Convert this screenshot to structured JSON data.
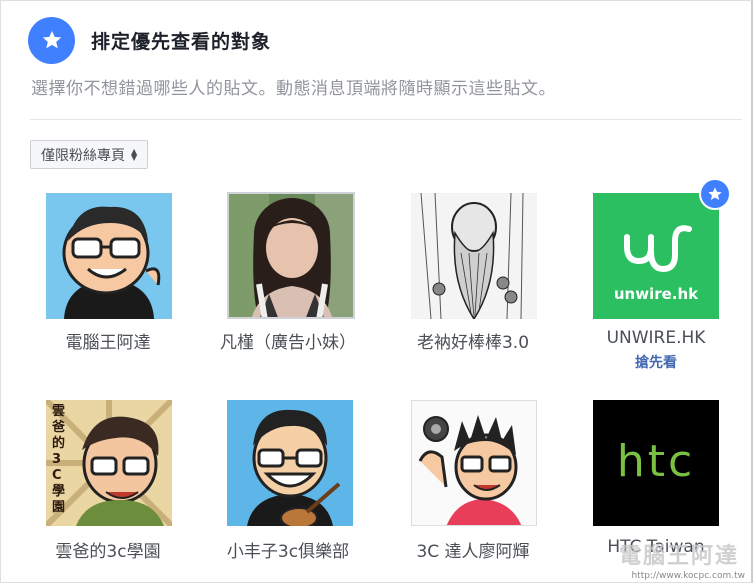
{
  "header": {
    "title": "排定優先查看的對象",
    "icon": "star-icon"
  },
  "description": "選擇你不想錯過哪些人的貼文。動態消息頂端將隨時顯示這些貼文。",
  "filter": {
    "label": "僅限粉絲專頁",
    "icon": "sort-arrows-icon"
  },
  "pages": [
    {
      "name": "電腦王阿達",
      "sub": ""
    },
    {
      "name": "凡槿（廣告小妹）",
      "sub": ""
    },
    {
      "name": "老衲好棒棒3.0",
      "sub": ""
    },
    {
      "name": "UNWIRE.HK",
      "sub": "搶先看",
      "logo_text": "unwire.hk",
      "prioritized": true
    },
    {
      "name": "雲爸的3c學園",
      "sub": "",
      "avatar_text": "雲爸的3C學園"
    },
    {
      "name": "小丰子3c俱樂部",
      "sub": ""
    },
    {
      "name": "3C 達人廖阿輝",
      "sub": ""
    },
    {
      "name": "HTC Taiwan",
      "sub": "",
      "logo_text": "htc"
    }
  ],
  "watermark": {
    "brand": "電腦王阿達",
    "url": "http://www.kocpc.com.tw"
  },
  "colors": {
    "accent": "#4080ff",
    "unwire": "#2bbf61",
    "htc": "#7ac143"
  }
}
